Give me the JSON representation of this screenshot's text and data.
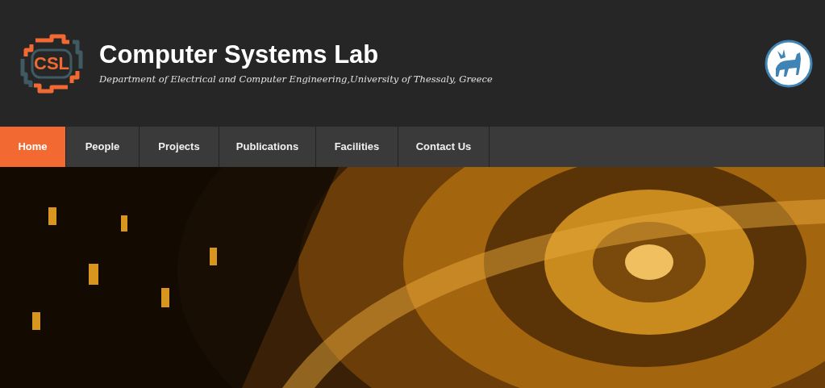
{
  "header": {
    "logo_text": "CSL",
    "title": "Computer Systems Lab",
    "subtitle": "Department of Electrical and Computer Engineering,University of Thessaly, Greece"
  },
  "nav": [
    {
      "label": "Home",
      "selected": true
    },
    {
      "label": "People",
      "selected": false
    },
    {
      "label": "Projects",
      "selected": false
    },
    {
      "label": "Publications",
      "selected": false
    },
    {
      "label": "Facilities",
      "selected": false
    },
    {
      "label": "Contact Us",
      "selected": false
    }
  ]
}
